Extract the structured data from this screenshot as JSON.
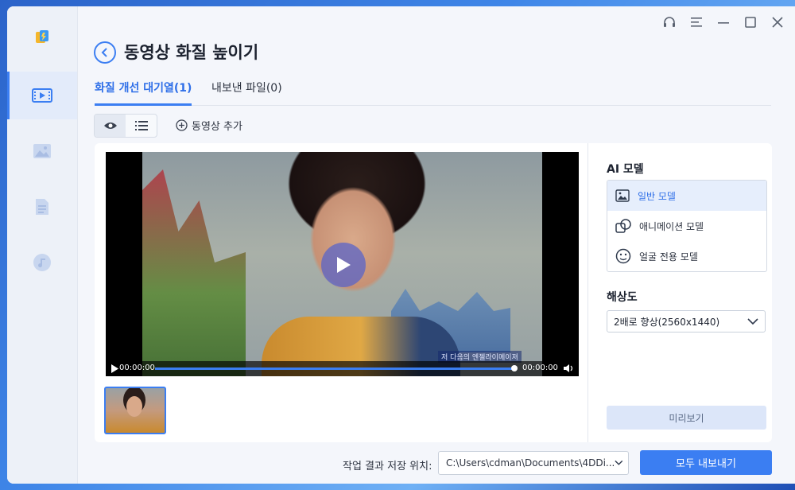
{
  "header": {
    "title": "동영상 화질 높이기"
  },
  "tabs": [
    {
      "label": "화질 개선 대기열(1)",
      "active": true
    },
    {
      "label": "내보낸 파일(0)",
      "active": false
    }
  ],
  "toolbar": {
    "add_video_label": "동영상 추가"
  },
  "player": {
    "current_time": "00:00:00",
    "duration": "00:00:00",
    "caption": "저 다음의 엔젤라이메이져"
  },
  "settings": {
    "model_title": "AI 모델",
    "models": [
      {
        "label": "일반 모델",
        "icon": "image-icon",
        "selected": true
      },
      {
        "label": "애니메이션 모델",
        "icon": "anime-icon",
        "selected": false
      },
      {
        "label": "얼굴 전용 모델",
        "icon": "face-icon",
        "selected": false
      }
    ],
    "resolution_title": "해상도",
    "resolution_value": "2배로 향상(2560x1440)",
    "preview_label": "미리보기"
  },
  "footer": {
    "save_location_label": "작업 결과 저장 위치:",
    "save_path": "C:\\Users\\cdman\\Documents\\4DDi...",
    "export_all_label": "모두 내보내기"
  },
  "colors": {
    "accent": "#3b7ef2",
    "active_tab": "#2f6fe8",
    "sidebar_bg": "#edf1f8",
    "panel_bg": "#ffffff"
  }
}
